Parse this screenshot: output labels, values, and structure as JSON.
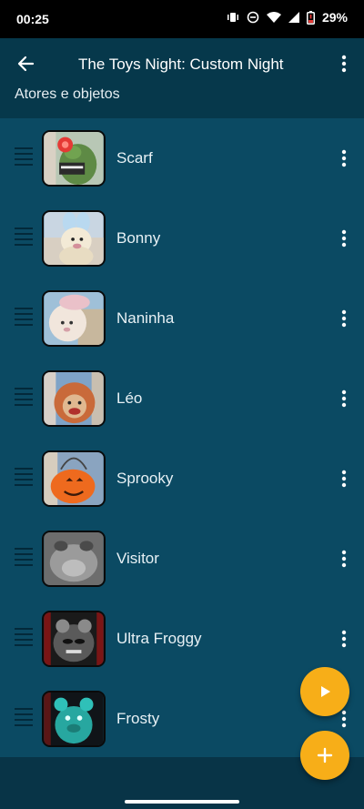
{
  "status_bar": {
    "time": "00:25",
    "battery": "29%",
    "icons": [
      "vibrate-icon",
      "dnd-icon",
      "wifi-icon",
      "signal-icon",
      "battery-icon"
    ]
  },
  "app_bar": {
    "title": "The Toys Night: Custom Night",
    "section_label": "Atores e objetos"
  },
  "items": [
    {
      "label": "Scarf"
    },
    {
      "label": "Bonny"
    },
    {
      "label": "Naninha"
    },
    {
      "label": "Léo"
    },
    {
      "label": "Sprooky"
    },
    {
      "label": "Visitor"
    },
    {
      "label": "Ultra Froggy"
    },
    {
      "label": "Frosty"
    }
  ],
  "colors": {
    "background": "#0b4a63",
    "app_bar": "#06384b",
    "fab": "#f7ae18"
  },
  "fabs": [
    "play-icon",
    "plus-icon"
  ]
}
